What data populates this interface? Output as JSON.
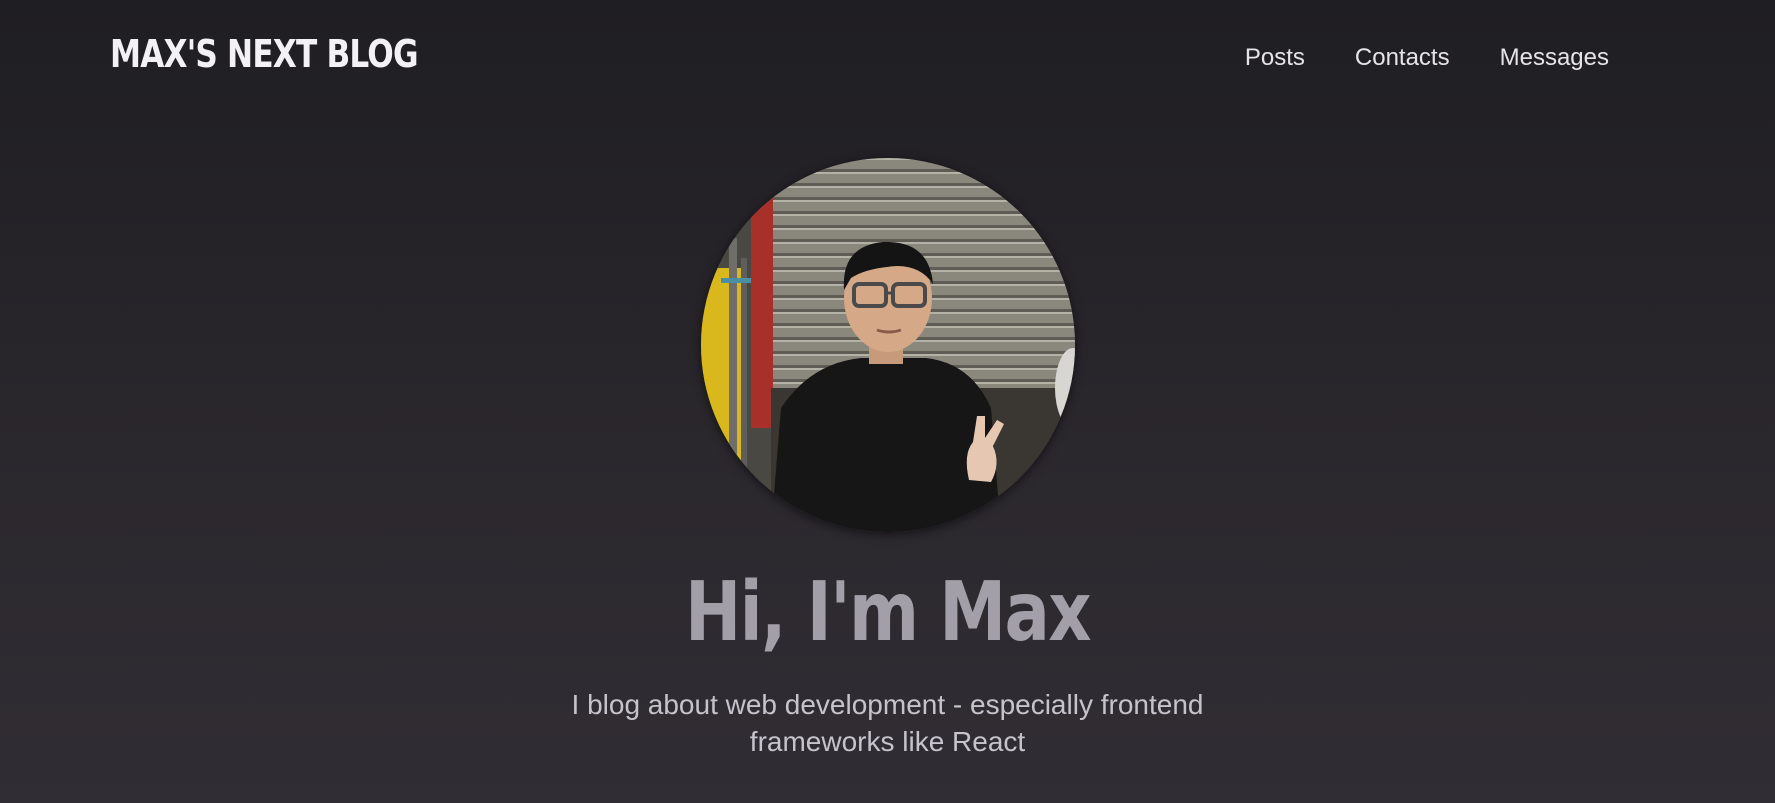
{
  "site": {
    "logo": "MAX'S NEXT BLOG"
  },
  "nav": {
    "items": [
      {
        "label": "Posts"
      },
      {
        "label": "Contacts"
      },
      {
        "label": "Messages"
      }
    ]
  },
  "hero": {
    "title": "Hi, I'm Max",
    "subtitle": "I blog about web development - especially frontend frameworks like React"
  }
}
